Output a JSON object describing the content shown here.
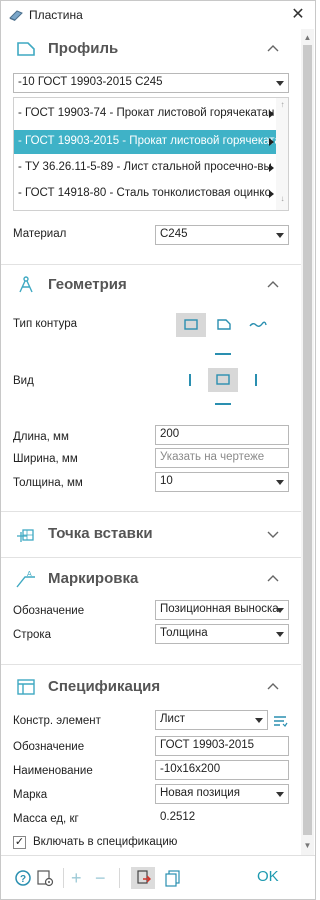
{
  "window": {
    "title": "Пластина",
    "icon": "plate-app-icon",
    "close_label": "✕"
  },
  "profile": {
    "title": "Профиль",
    "icon": "profile-section-icon",
    "standard_value": "-10 ГОСТ 19903-2015 С245",
    "items": [
      {
        "label": "- ГОСТ 19903-74 - Прокат листовой горячекатан",
        "selected": false
      },
      {
        "label": "- ГОСТ 19903-2015 - Прокат листовой горячекатан",
        "selected": true
      },
      {
        "label": "- ТУ 36.26.11-5-89 - Лист стальной просечно-вы",
        "selected": false
      },
      {
        "label": "- ГОСТ 14918-80 - Сталь тонколистовая оцинко",
        "selected": false
      }
    ],
    "material_label": "Материал",
    "material_value": "С245"
  },
  "geometry": {
    "title": "Геометрия",
    "icon": "compass-icon",
    "contour_label": "Тип контура",
    "view_label": "Вид",
    "length_label": "Длина, мм",
    "length_value": "200",
    "width_label": "Ширина, мм",
    "width_placeholder": "Указать на чертеже",
    "thickness_label": "Толщина, мм",
    "thickness_value": "10"
  },
  "insert_point": {
    "title": "Точка вставки",
    "icon": "insert-point-icon"
  },
  "marking": {
    "title": "Маркировка",
    "icon": "marking-icon",
    "designation_label": "Обозначение",
    "designation_value": "Позиционная выноска",
    "line_label": "Строка",
    "line_value": "Толщина"
  },
  "specification": {
    "title": "Спецификация",
    "icon": "table-icon",
    "element_label": "Констр. элемент",
    "element_value": "Лист",
    "designation_label": "Обозначение",
    "designation_value": "ГОСТ 19903-2015",
    "name_label": "Наименование",
    "name_value": "-10x16x200",
    "mark_label": "Марка",
    "mark_value": "Новая позиция",
    "mass_label": "Масса ед, кг",
    "mass_value": "0.2512",
    "include_label": "Включать в спецификацию",
    "include_checked": "✓"
  },
  "footer": {
    "ok_label": "OK"
  },
  "colors": {
    "accent": "#3fb2c7",
    "ok": "#1e9ab0",
    "heading": "#555555"
  }
}
